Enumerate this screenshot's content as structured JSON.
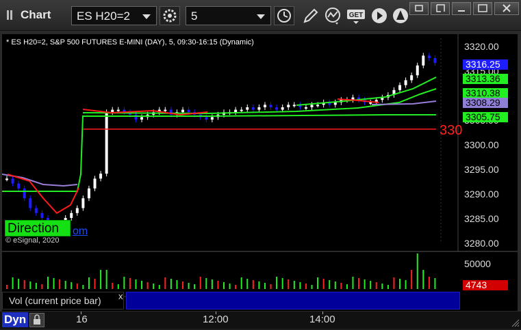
{
  "window": {
    "title": "Chart",
    "symbol_value": "ES H20=2",
    "interval_value": "5",
    "buttons": [
      "settings-icon",
      "clock-icon",
      "draw-pencil-icon",
      "study-icon",
      "get-icon",
      "play-icon",
      "alert-icon"
    ],
    "win_controls": [
      "restore-down",
      "restore",
      "maximize",
      "close"
    ],
    "get_label": "GET"
  },
  "chart": {
    "header": "* ES H20=2, S&P 500 FUTURES E-MINI (DAY), 5, 09:30-16:15 (Dynamic)",
    "copyright": "© eSignal, 2020",
    "direction_label": "Direction",
    "partial_link": "om",
    "partial_price_label": "330",
    "price_ticks": [
      "3320.00",
      "3315.00",
      "3310.00",
      "3305.00",
      "3300.00",
      "3295.00",
      "3290.00",
      "3285.00",
      "3280.00"
    ],
    "tags": {
      "last": "3316.25",
      "ma1": "3313.36",
      "ma2": "3310.38",
      "ma3": "3308.29",
      "ma4": "3305.75"
    },
    "colors": {
      "up": "#ffffff",
      "down": "#1c1cff",
      "ma_green": "#22ee22",
      "ma_red": "#ff1a1a",
      "ma_purple": "#9a7fd8",
      "support": "#ff1a1a"
    }
  },
  "volume": {
    "legend": "Vol (current price bar)",
    "close_glyph": "x",
    "tick": "50000",
    "last_value": "4743"
  },
  "time_axis": {
    "mode_label": "Dyn",
    "labels": [
      "16",
      "12:00",
      "14:00"
    ]
  }
}
